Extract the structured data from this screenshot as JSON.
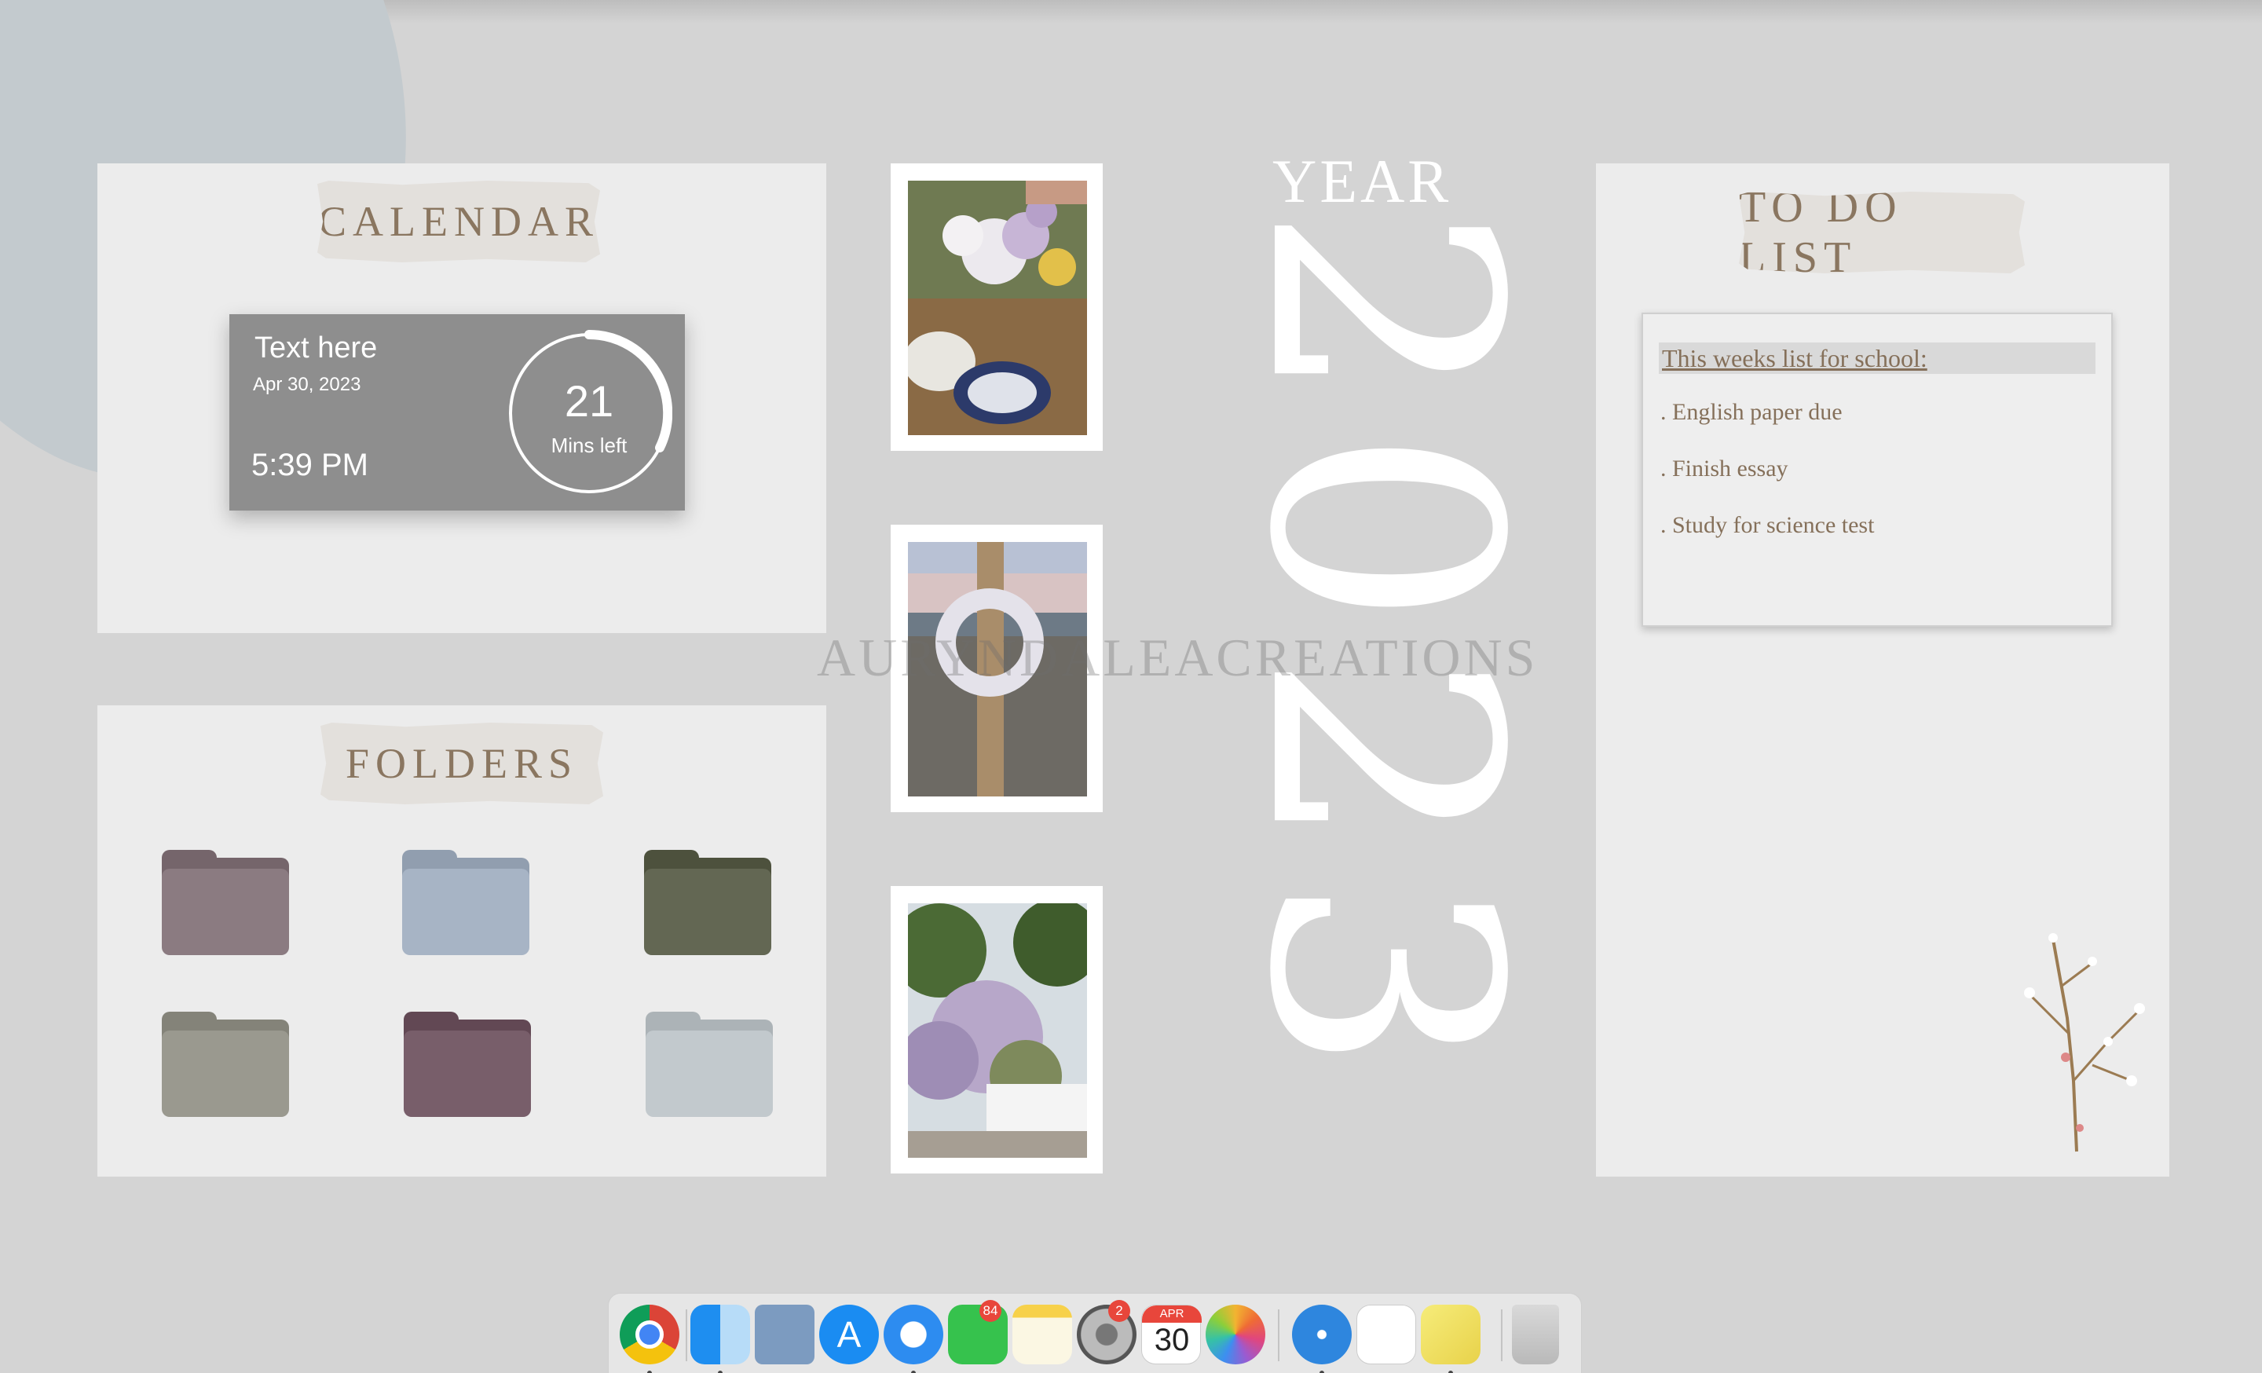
{
  "calendar": {
    "title": "CALENDAR",
    "widget": {
      "title": "Text here",
      "date": "Apr 30, 2023",
      "time": "5:39 PM",
      "countdown": "21",
      "countdown_label": "Mins left"
    }
  },
  "folders": {
    "title": "FOLDERS",
    "items": [
      {
        "color": "#8b7b81"
      },
      {
        "color": "#a7b4c5"
      },
      {
        "color": "#636753"
      },
      {
        "color": "#9a998f"
      },
      {
        "color": "#785e6a"
      },
      {
        "color": "#c2c9cd"
      }
    ]
  },
  "year": {
    "label": "YEAR",
    "number": "2023"
  },
  "watermark": "AURYNDALEACREATIONS",
  "todo": {
    "title": "TO DO LIST",
    "heading": "This weeks list for school:",
    "items": [
      " . English paper due",
      ". Finish essay",
      ". Study for science test"
    ]
  },
  "dock": {
    "apps": [
      {
        "name": "chrome-icon",
        "running": true
      },
      {
        "name": "finder-icon",
        "running": true
      },
      {
        "name": "preview-icon",
        "running": false
      },
      {
        "name": "app-store-icon",
        "running": false
      },
      {
        "name": "safari-icon",
        "running": true
      },
      {
        "name": "facetime-icon",
        "running": false,
        "badge": "84"
      },
      {
        "name": "notes-icon",
        "running": false
      },
      {
        "name": "system-preferences-icon",
        "running": false,
        "badge": "2"
      },
      {
        "name": "calendar-icon",
        "running": false,
        "month": "APR",
        "day": "30"
      },
      {
        "name": "photos-icon",
        "running": false
      },
      {
        "name": "compass-icon",
        "running": true
      },
      {
        "name": "reminders-icon",
        "running": false
      },
      {
        "name": "stickies-icon",
        "running": true
      },
      {
        "name": "trash-icon",
        "running": false
      }
    ]
  }
}
